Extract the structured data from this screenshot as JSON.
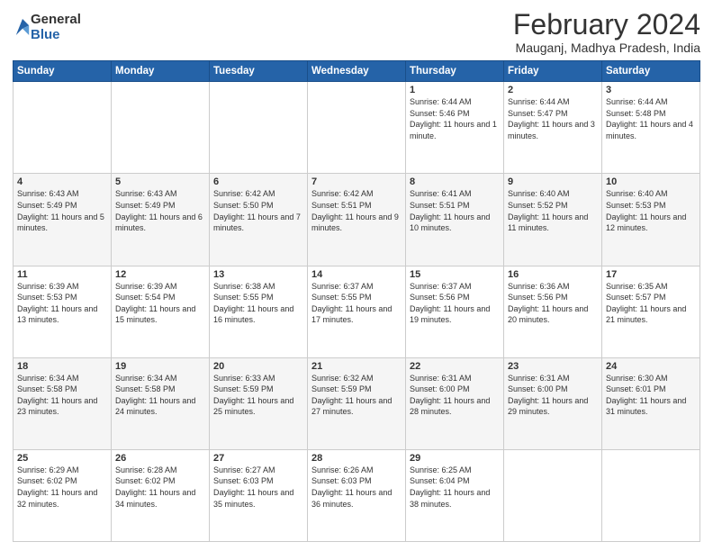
{
  "logo": {
    "general": "General",
    "blue": "Blue"
  },
  "header": {
    "title": "February 2024",
    "subtitle": "Mauganj, Madhya Pradesh, India"
  },
  "days_of_week": [
    "Sunday",
    "Monday",
    "Tuesday",
    "Wednesday",
    "Thursday",
    "Friday",
    "Saturday"
  ],
  "weeks": [
    [
      {
        "day": "",
        "info": ""
      },
      {
        "day": "",
        "info": ""
      },
      {
        "day": "",
        "info": ""
      },
      {
        "day": "",
        "info": ""
      },
      {
        "day": "1",
        "info": "Sunrise: 6:44 AM\nSunset: 5:46 PM\nDaylight: 11 hours and 1 minute."
      },
      {
        "day": "2",
        "info": "Sunrise: 6:44 AM\nSunset: 5:47 PM\nDaylight: 11 hours and 3 minutes."
      },
      {
        "day": "3",
        "info": "Sunrise: 6:44 AM\nSunset: 5:48 PM\nDaylight: 11 hours and 4 minutes."
      }
    ],
    [
      {
        "day": "4",
        "info": "Sunrise: 6:43 AM\nSunset: 5:49 PM\nDaylight: 11 hours and 5 minutes."
      },
      {
        "day": "5",
        "info": "Sunrise: 6:43 AM\nSunset: 5:49 PM\nDaylight: 11 hours and 6 minutes."
      },
      {
        "day": "6",
        "info": "Sunrise: 6:42 AM\nSunset: 5:50 PM\nDaylight: 11 hours and 7 minutes."
      },
      {
        "day": "7",
        "info": "Sunrise: 6:42 AM\nSunset: 5:51 PM\nDaylight: 11 hours and 9 minutes."
      },
      {
        "day": "8",
        "info": "Sunrise: 6:41 AM\nSunset: 5:51 PM\nDaylight: 11 hours and 10 minutes."
      },
      {
        "day": "9",
        "info": "Sunrise: 6:40 AM\nSunset: 5:52 PM\nDaylight: 11 hours and 11 minutes."
      },
      {
        "day": "10",
        "info": "Sunrise: 6:40 AM\nSunset: 5:53 PM\nDaylight: 11 hours and 12 minutes."
      }
    ],
    [
      {
        "day": "11",
        "info": "Sunrise: 6:39 AM\nSunset: 5:53 PM\nDaylight: 11 hours and 13 minutes."
      },
      {
        "day": "12",
        "info": "Sunrise: 6:39 AM\nSunset: 5:54 PM\nDaylight: 11 hours and 15 minutes."
      },
      {
        "day": "13",
        "info": "Sunrise: 6:38 AM\nSunset: 5:55 PM\nDaylight: 11 hours and 16 minutes."
      },
      {
        "day": "14",
        "info": "Sunrise: 6:37 AM\nSunset: 5:55 PM\nDaylight: 11 hours and 17 minutes."
      },
      {
        "day": "15",
        "info": "Sunrise: 6:37 AM\nSunset: 5:56 PM\nDaylight: 11 hours and 19 minutes."
      },
      {
        "day": "16",
        "info": "Sunrise: 6:36 AM\nSunset: 5:56 PM\nDaylight: 11 hours and 20 minutes."
      },
      {
        "day": "17",
        "info": "Sunrise: 6:35 AM\nSunset: 5:57 PM\nDaylight: 11 hours and 21 minutes."
      }
    ],
    [
      {
        "day": "18",
        "info": "Sunrise: 6:34 AM\nSunset: 5:58 PM\nDaylight: 11 hours and 23 minutes."
      },
      {
        "day": "19",
        "info": "Sunrise: 6:34 AM\nSunset: 5:58 PM\nDaylight: 11 hours and 24 minutes."
      },
      {
        "day": "20",
        "info": "Sunrise: 6:33 AM\nSunset: 5:59 PM\nDaylight: 11 hours and 25 minutes."
      },
      {
        "day": "21",
        "info": "Sunrise: 6:32 AM\nSunset: 5:59 PM\nDaylight: 11 hours and 27 minutes."
      },
      {
        "day": "22",
        "info": "Sunrise: 6:31 AM\nSunset: 6:00 PM\nDaylight: 11 hours and 28 minutes."
      },
      {
        "day": "23",
        "info": "Sunrise: 6:31 AM\nSunset: 6:00 PM\nDaylight: 11 hours and 29 minutes."
      },
      {
        "day": "24",
        "info": "Sunrise: 6:30 AM\nSunset: 6:01 PM\nDaylight: 11 hours and 31 minutes."
      }
    ],
    [
      {
        "day": "25",
        "info": "Sunrise: 6:29 AM\nSunset: 6:02 PM\nDaylight: 11 hours and 32 minutes."
      },
      {
        "day": "26",
        "info": "Sunrise: 6:28 AM\nSunset: 6:02 PM\nDaylight: 11 hours and 34 minutes."
      },
      {
        "day": "27",
        "info": "Sunrise: 6:27 AM\nSunset: 6:03 PM\nDaylight: 11 hours and 35 minutes."
      },
      {
        "day": "28",
        "info": "Sunrise: 6:26 AM\nSunset: 6:03 PM\nDaylight: 11 hours and 36 minutes."
      },
      {
        "day": "29",
        "info": "Sunrise: 6:25 AM\nSunset: 6:04 PM\nDaylight: 11 hours and 38 minutes."
      },
      {
        "day": "",
        "info": ""
      },
      {
        "day": "",
        "info": ""
      }
    ]
  ]
}
